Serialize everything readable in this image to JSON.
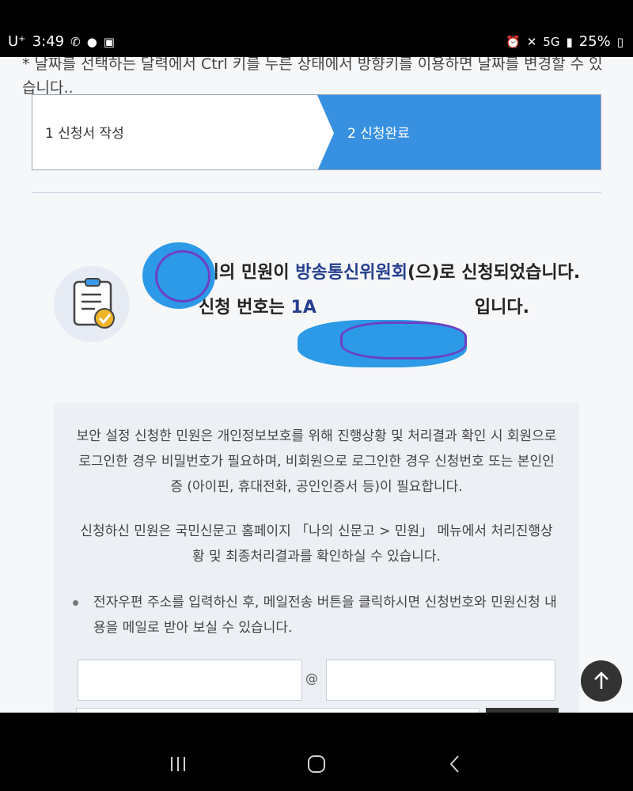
{
  "status_bar": {
    "carrier": "U⁺",
    "time": "3:49",
    "battery": "25%",
    "left_icons": [
      "missed-call-icon",
      "chat-icon",
      "gallery-icon"
    ],
    "right_icons": [
      "alarm-icon",
      "mute-icon",
      "5g-icon",
      "signal-icon",
      "battery-icon"
    ]
  },
  "page": {
    "note": "* 날짜를 선택하는 달력에서 Ctrl 키를 누른 상태에서 방향키를 이용하면 날짜를 변경할 수 있습니다..",
    "steps": [
      {
        "label": "1 신청서 작성",
        "active": false
      },
      {
        "label": "2 신청완료",
        "active": true
      }
    ],
    "message": {
      "part1": "님의 민원이 ",
      "agency": "방송통신위원회",
      "part2": "(으)로 신청되었습니다.",
      "number_prefix": "신청 번호는 ",
      "number_visible": "1A",
      "number_suffix": "입니다."
    },
    "info": {
      "para1": "보안 설정 신청한 민원은 개인정보보호를 위해 진행상황 및 처리결과 확인 시 회원으로 로그인한 경우 비밀번호가 필요하며, 비회원으로 로그인한 경우 신청번호 또는 본인인증 (아이핀, 휴대전화, 공인인증서 등)이 필요합니다.",
      "para2": "신청하신 민원은 국민신문고 홈페이지 「나의 신문고 > 민원」 메뉴에서 처리진행상황 및 최종처리결과를 확인하실 수 있습니다.",
      "bullet": "전자우편 주소를 입력하신 후, 메일전송 버튼을 클릭하시면 신청번호와 민원신청 내용을 메일로 받아 보실 수 있습니다.",
      "at_sign": "@"
    }
  },
  "colors": {
    "active_step": "#3891e0",
    "agency_text": "#26408e",
    "redaction_blue": "#2c9ae6",
    "redaction_purple": "#6d3fc4"
  }
}
